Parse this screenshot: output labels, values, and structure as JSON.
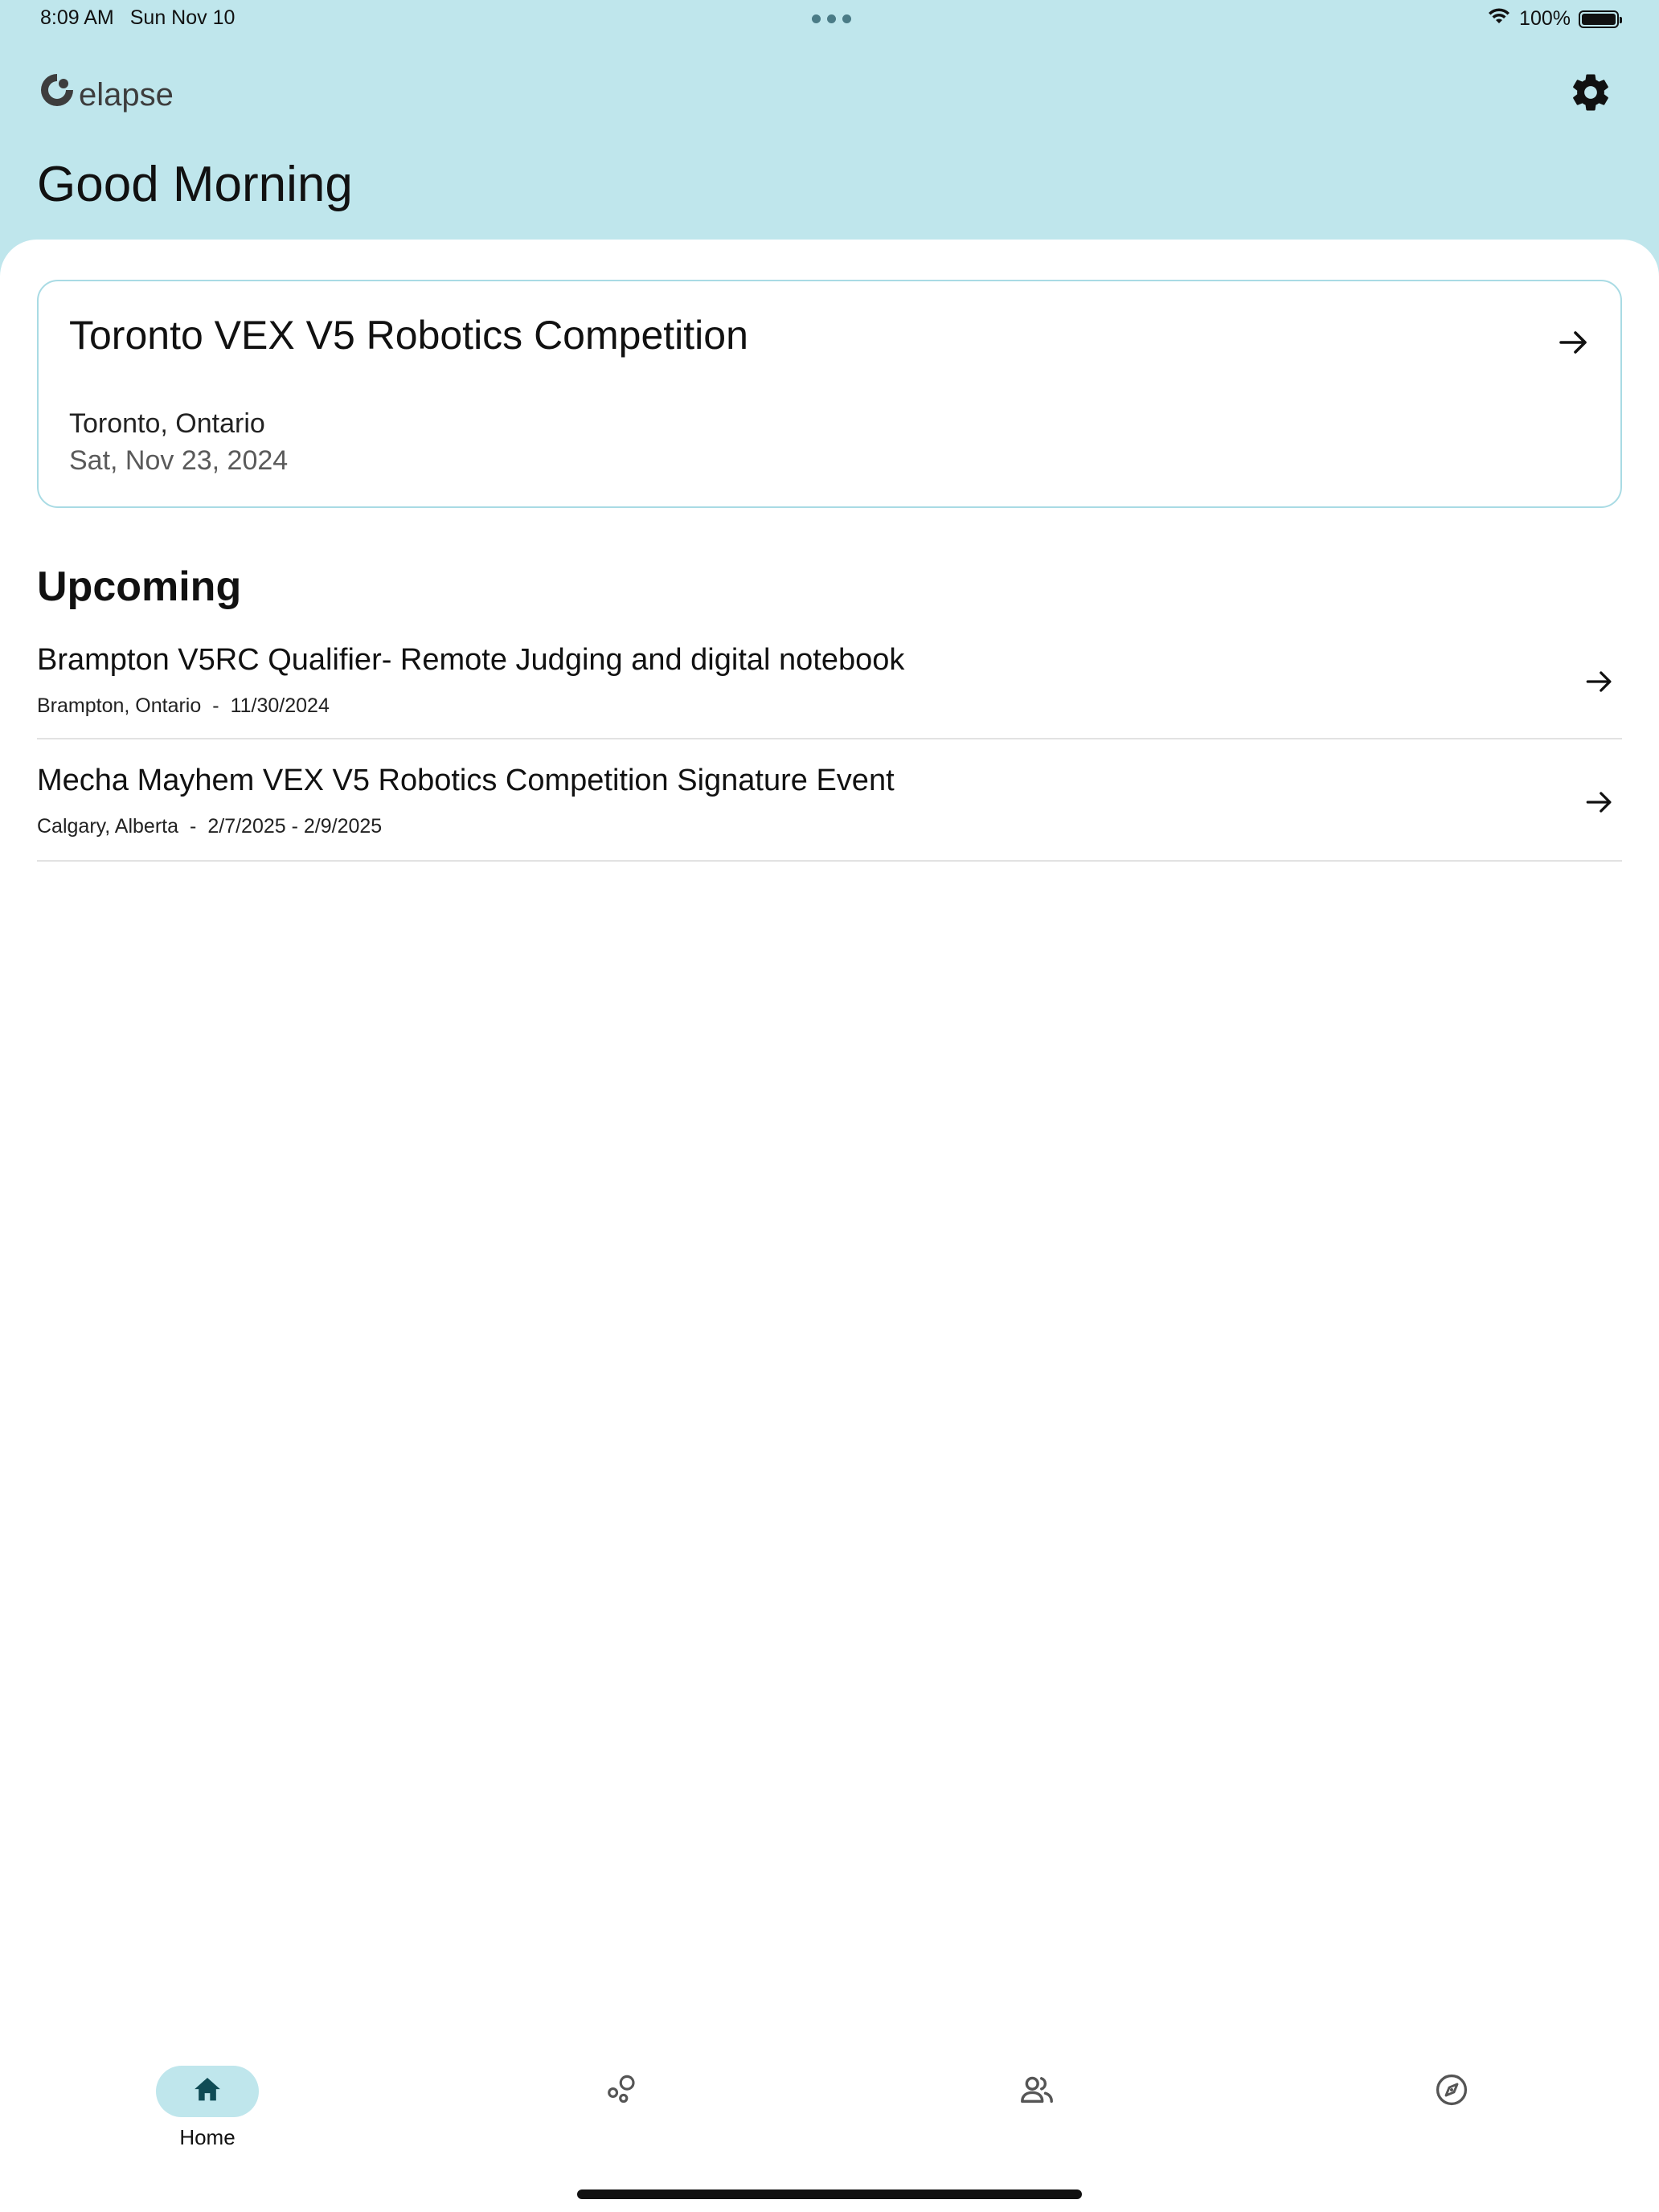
{
  "status_bar": {
    "time": "8:09 AM",
    "date": "Sun Nov 10",
    "battery": "100%"
  },
  "header": {
    "logo_text": "elapse",
    "greeting": "Good Morning"
  },
  "featured_event": {
    "title": "Toronto VEX V5 Robotics Competition",
    "location": "Toronto, Ontario",
    "date": "Sat, Nov 23, 2024"
  },
  "upcoming": {
    "title": "Upcoming",
    "events": [
      {
        "title": "Brampton V5RC Qualifier- Remote Judging and digital notebook",
        "location": "Brampton, Ontario",
        "separator": "-",
        "dates": "11/30/2024"
      },
      {
        "title": "Mecha Mayhem VEX V5 Robotics Competition Signature Event",
        "location": "Calgary, Alberta",
        "separator": "-",
        "dates": "2/7/2025 - 2/9/2025"
      }
    ]
  },
  "bottom_nav": {
    "items": [
      {
        "label": "Home",
        "icon": "home-icon",
        "active": true
      },
      {
        "label": "",
        "icon": "bubbles-icon",
        "active": false
      },
      {
        "label": "",
        "icon": "people-icon",
        "active": false
      },
      {
        "label": "",
        "icon": "compass-icon",
        "active": false
      }
    ]
  },
  "colors": {
    "header_bg": "#bfe6ec",
    "card_border": "#a9dbe4",
    "active_icon": "#0f4b55"
  }
}
